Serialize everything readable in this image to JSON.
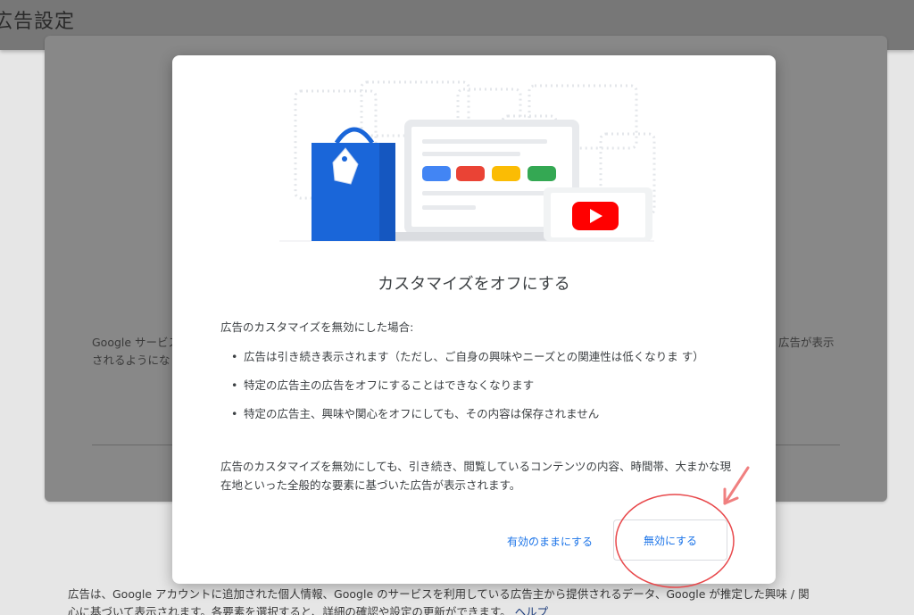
{
  "background": {
    "page_title": "広告設定",
    "left_text_line1": "Google サービス",
    "left_text_line2": "されるようにな",
    "right_text": "広告が表示",
    "footer_line1": "広告は、Google アカウントに追加された個人情報、Google のサービスを利用している広告主から提供されるデータ、Google が推定した興味 / 関",
    "footer_line2": "心に基づいて表示されます。各要素を選択すると、詳細の確認や設定の更新ができます。",
    "help_link": "ヘルプ"
  },
  "dialog": {
    "title": "カスタマイズをオフにする",
    "intro": "広告のカスタマイズを無効にした場合:",
    "bullets": [
      "広告は引き続き表示されます（ただし、ご自身の興味やニーズとの関連性は低くなりま す）",
      "特定の広告主の広告をオフにすることはできなくなります",
      "特定の広告主、興味や関心をオフにしても、その内容は保存されません"
    ],
    "note": "広告のカスタマイズを無効にしても、引き続き、閲覧しているコンテンツの内容、時間帯、大まかな現在地といった全般的な要素に基づいた広告が表示されます。",
    "keep_button": "有効のままにする",
    "disable_button": "無効にする"
  },
  "colors": {
    "accent": "#1a73e8",
    "annotation": "#e8484b",
    "bag_blue": "#1a66d9",
    "chip_blue": "#4285f4",
    "chip_red": "#ea4335",
    "chip_yellow": "#fbbc04",
    "chip_green": "#34a853",
    "youtube_red": "#ff0000"
  }
}
